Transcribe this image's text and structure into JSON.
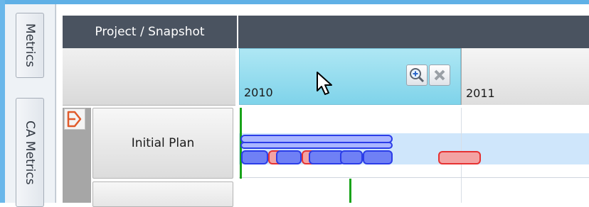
{
  "side_tabs": [
    "Metrics",
    "CA Metrics"
  ],
  "header": {
    "project_label": "Project / Snapshot"
  },
  "timeline": {
    "years": [
      "2010",
      "2011"
    ],
    "icons": {
      "zoom": "zoom-in-icon",
      "close": "close-icon",
      "expand": "expand-arrow-icon"
    }
  },
  "rows": [
    {
      "label": "Initial  Plan"
    },
    {
      "label": ""
    }
  ],
  "colors": {
    "header": "#4a5360",
    "selected_year": "#7fd3ea",
    "bar_blue": "#2b3de8",
    "bar_red": "#e63232",
    "today_line": "#19a31a"
  }
}
